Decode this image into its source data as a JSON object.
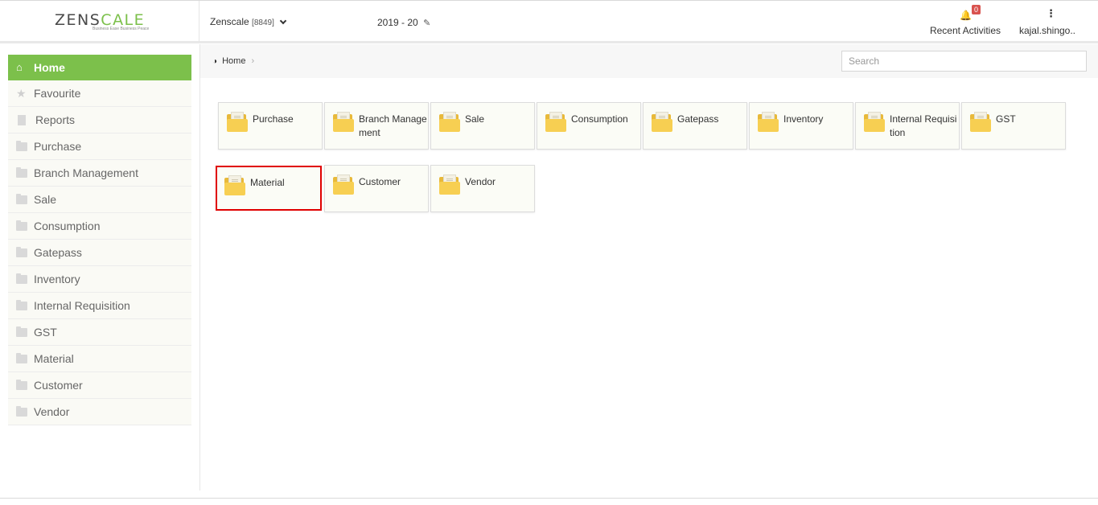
{
  "header": {
    "logo_prefix": "ZENS",
    "logo_accent": "CALE",
    "logo_tagline": "Business Ease Business Peace",
    "company_name": "Zenscale",
    "company_code": "[8849]",
    "financial_year": "2019 - 20",
    "notifications_count": "0",
    "recent_activities_label": "Recent Activities",
    "user_name": "kajal.shingo.."
  },
  "sidebar": {
    "items": [
      {
        "label": "Home",
        "icon": "home-icon",
        "active": true
      },
      {
        "label": "Favourite",
        "icon": "star-icon"
      },
      {
        "label": "Reports",
        "icon": "file-icon"
      },
      {
        "label": "Purchase",
        "icon": "folder-icon"
      },
      {
        "label": "Branch Management",
        "icon": "folder-icon"
      },
      {
        "label": "Sale",
        "icon": "folder-icon"
      },
      {
        "label": "Consumption",
        "icon": "folder-icon"
      },
      {
        "label": "Gatepass",
        "icon": "folder-icon"
      },
      {
        "label": "Inventory",
        "icon": "folder-icon"
      },
      {
        "label": "Internal Requisition",
        "icon": "folder-icon"
      },
      {
        "label": "GST",
        "icon": "folder-icon"
      },
      {
        "label": "Material",
        "icon": "folder-icon"
      },
      {
        "label": "Customer",
        "icon": "folder-icon"
      },
      {
        "label": "Vendor",
        "icon": "folder-icon"
      }
    ]
  },
  "breadcrumb": {
    "home_label": "Home"
  },
  "search": {
    "placeholder": "Search"
  },
  "tiles": [
    {
      "label": "Purchase"
    },
    {
      "label": "Branch Management"
    },
    {
      "label": "Sale"
    },
    {
      "label": "Consumption"
    },
    {
      "label": "Gatepass"
    },
    {
      "label": "Inventory"
    },
    {
      "label": "Internal Requisition"
    },
    {
      "label": "GST"
    },
    {
      "label": "Material",
      "highlighted": true
    },
    {
      "label": "Customer"
    },
    {
      "label": "Vendor"
    }
  ],
  "colors": {
    "accent": "#7cc04b",
    "highlight": "#e00000",
    "badge": "#d9534f",
    "folder": "#f7cf52"
  }
}
